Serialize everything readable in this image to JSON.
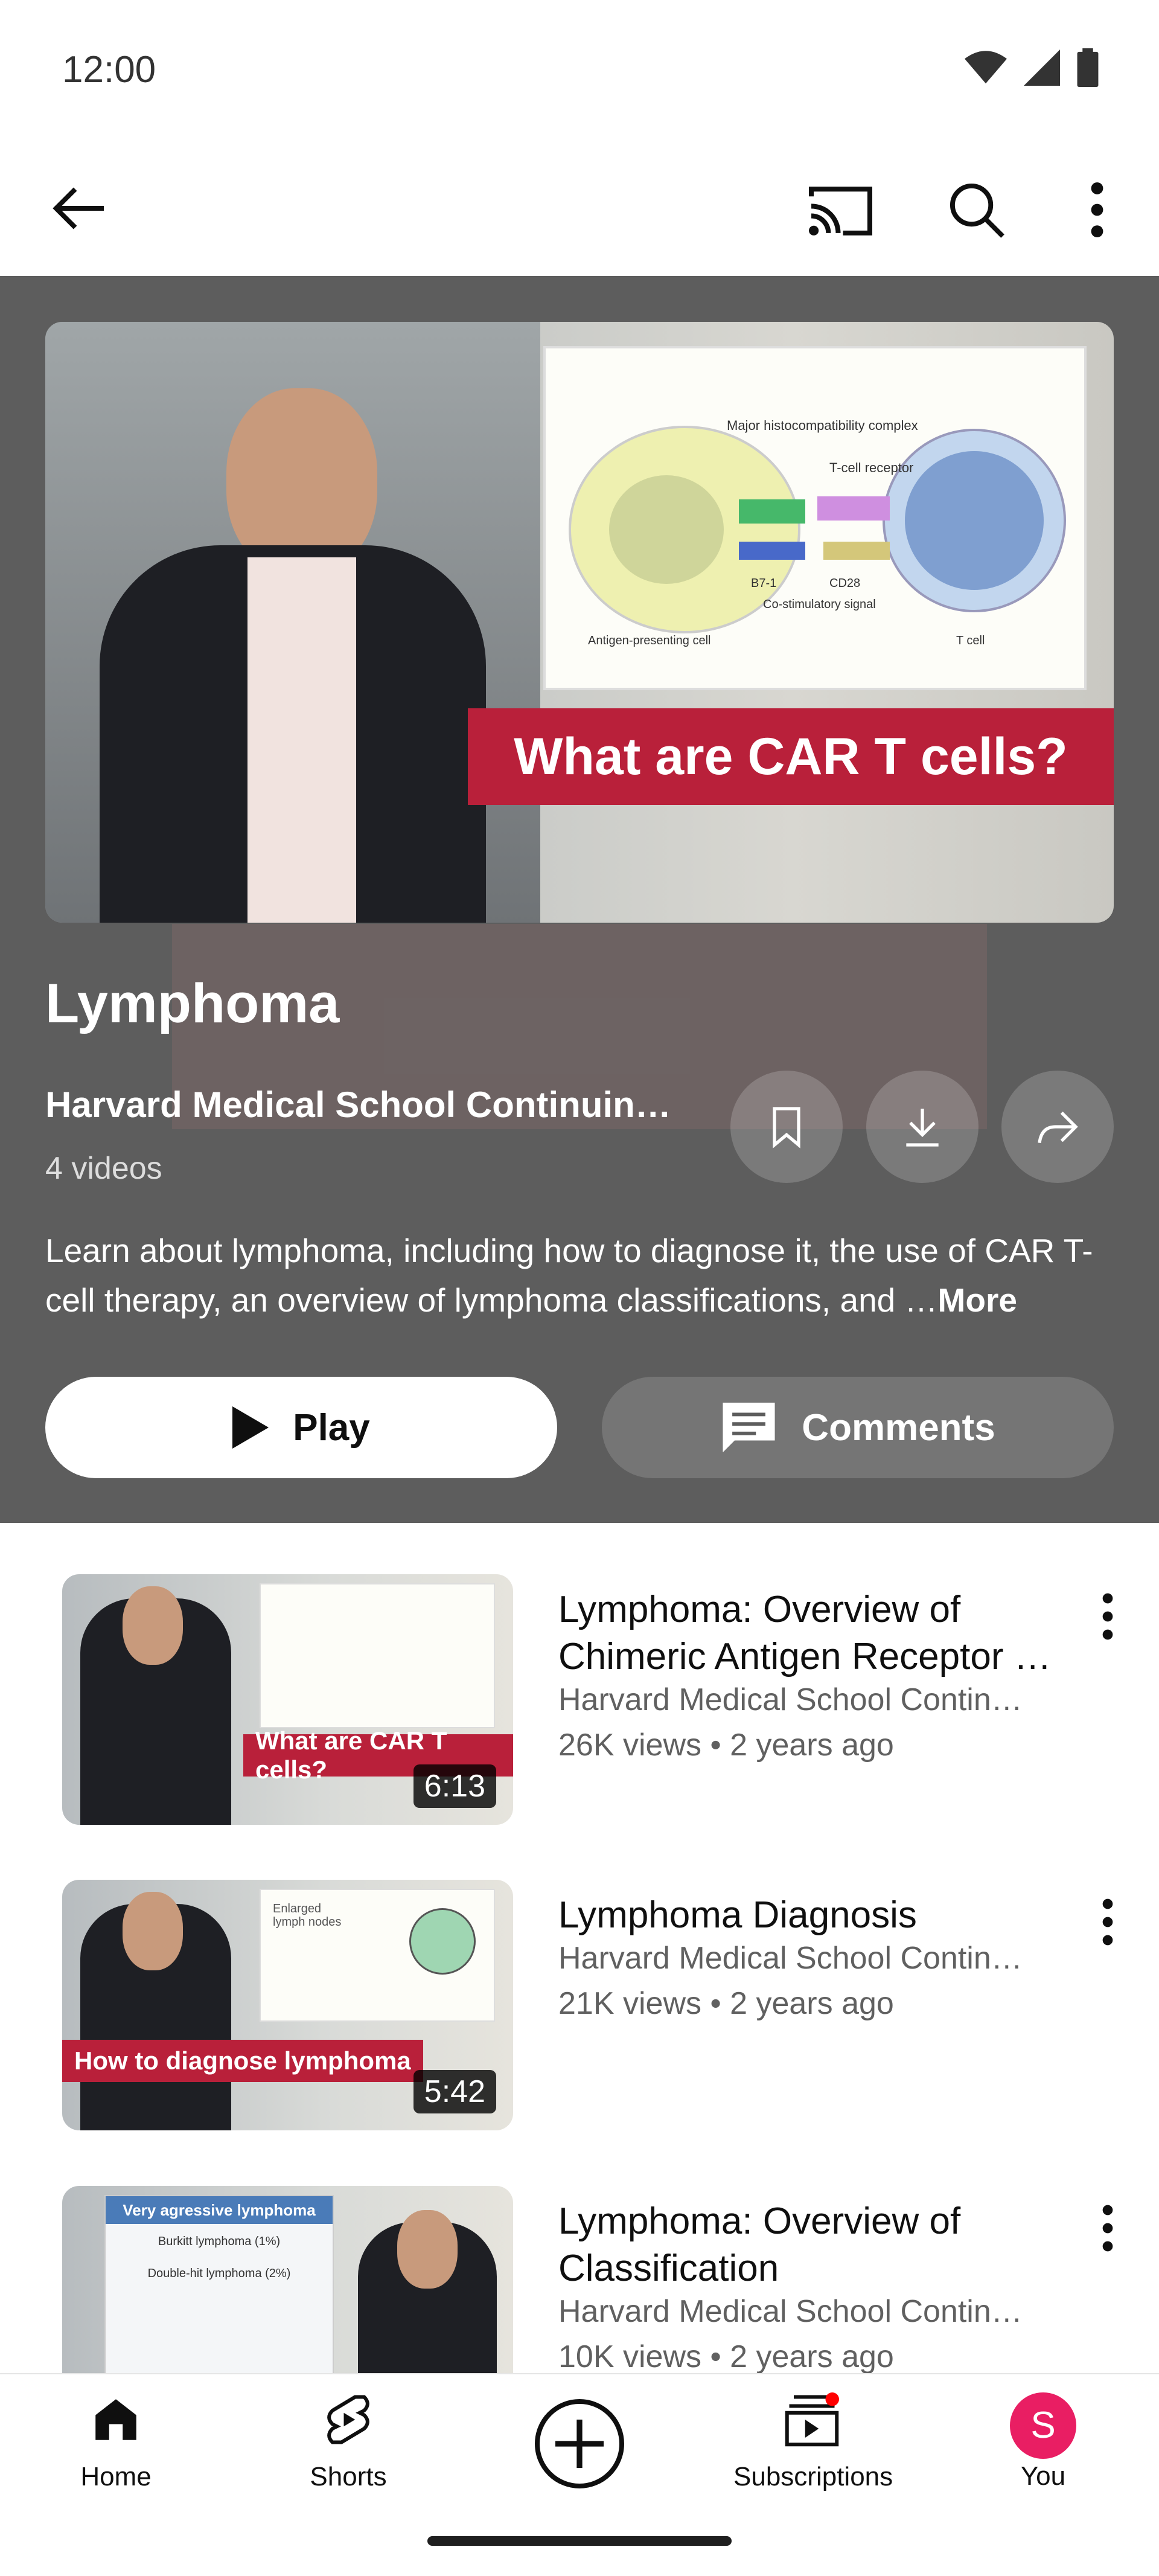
{
  "status_bar": {
    "time": "12:00"
  },
  "playlist": {
    "title": "Lymphoma",
    "channel": "Harvard Medical School Continuin…",
    "video_count": "4 videos",
    "description": "Learn about lymphoma, including how to diagnose it, the use of CAR T-cell therapy, an overview of lymphoma classifications, and …",
    "more_label": "More",
    "hero_banner_text": "What are CAR T cells?",
    "hero_diagram_labels": {
      "mhc": "Major histocompatibility complex",
      "tcr": "T-cell receptor",
      "b71": "B7-1",
      "cd28": "CD28",
      "costim": "Co-stimulatory signal",
      "apc": "Antigen-presenting cell",
      "tcell": "T cell"
    },
    "play_label": "Play",
    "comments_label": "Comments"
  },
  "videos": [
    {
      "title": "Lymphoma: Overview of Chimeric Antigen Receptor …",
      "channel": "Harvard Medical School Contin…",
      "meta": "26K views • 2 years ago",
      "duration": "6:13",
      "thumb_text": "What are CAR T cells?"
    },
    {
      "title": "Lymphoma Diagnosis",
      "channel": "Harvard Medical School Contin…",
      "meta": "21K views • 2 years ago",
      "duration": "5:42",
      "thumb_text": "How to diagnose lymphoma",
      "thumb_label": "Enlarged lymph nodes"
    },
    {
      "title": "Lymphoma: Overview of Classification",
      "channel": "Harvard Medical School Contin…",
      "meta": "10K views • 2 years ago",
      "thumb_header": "Very agressive lymphoma",
      "thumb_line1": "Burkitt lymphoma (1%)",
      "thumb_line2": "Double-hit lymphoma (2%)"
    }
  ],
  "nav": {
    "home": "Home",
    "shorts": "Shorts",
    "subscriptions": "Subscriptions",
    "you": "You",
    "avatar_letter": "S"
  },
  "colors": {
    "header_bg": "#5d5d5d",
    "banner_red": "#b9203a",
    "avatar": "#e91e63",
    "notif_dot": "#ff0000"
  }
}
